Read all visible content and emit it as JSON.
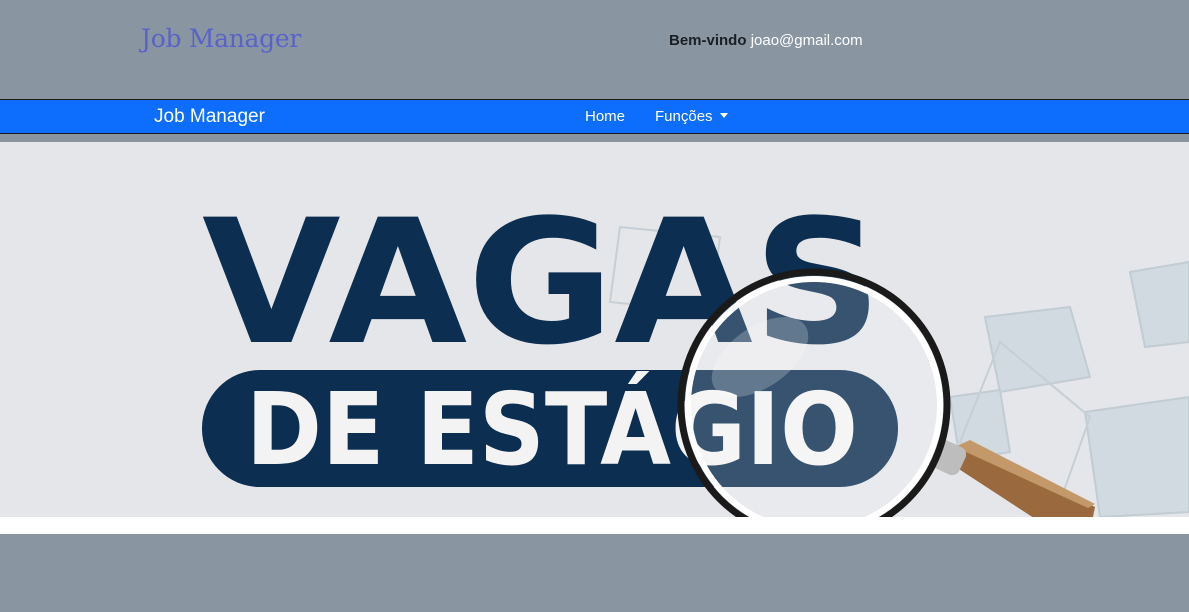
{
  "header": {
    "brand": "Job Manager",
    "welcome_label": "Bem-vindo",
    "user_email": "joao@gmail.com"
  },
  "navbar": {
    "brand": "Job Manager",
    "items": [
      {
        "label": "Home"
      },
      {
        "label": "Funções",
        "dropdown": true,
        "icon": "caret-down-icon"
      }
    ]
  },
  "banner": {
    "title_line1": "VAGAS",
    "title_line2": "DE ESTÁGIO",
    "colors": {
      "dark_navy": "#0c2e50",
      "background": "#e4e6e9"
    },
    "icon": "magnifying-glass-icon"
  },
  "colors": {
    "page_background": "#8996a2",
    "navbar": "#0d6efd",
    "brand_text": "#5a62c9"
  }
}
